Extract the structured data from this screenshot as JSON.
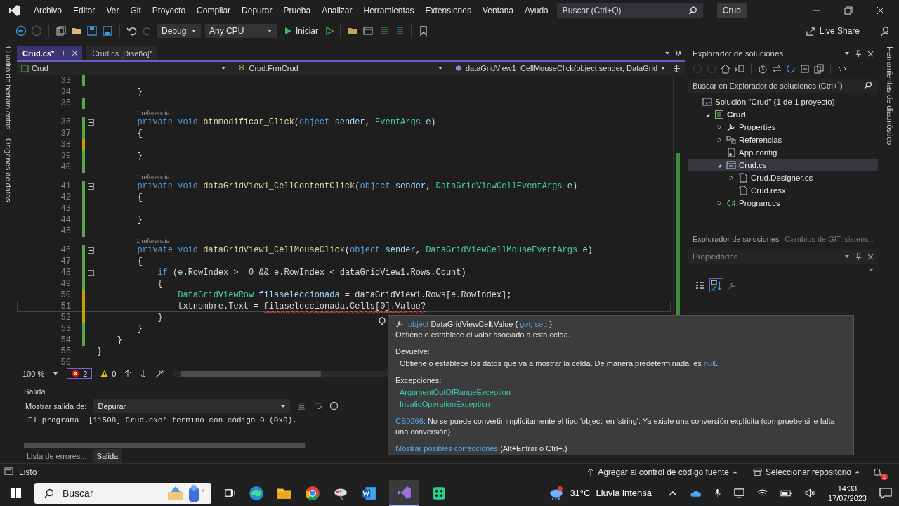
{
  "menu": [
    "Archivo",
    "Editar",
    "Ver",
    "Git",
    "Proyecto",
    "Compilar",
    "Depurar",
    "Prueba",
    "Analizar",
    "Herramientas",
    "Extensiones",
    "Ventana",
    "Ayuda"
  ],
  "search": {
    "placeholder": "Buscar (Ctrl+Q)"
  },
  "window": {
    "title": "Crud"
  },
  "toolbar": {
    "configuration": "Debug",
    "platform": "Any CPU",
    "start": "Iniciar",
    "live_share": "Live Share"
  },
  "left_tool_tabs": [
    "Cuadro de herramientas",
    "Orígenes de datos"
  ],
  "right_tool_tabs": [
    "Herramientas de diagnóstico"
  ],
  "document_tabs": [
    {
      "label": "Crud.cs*",
      "selected": true
    },
    {
      "label": "Crud.cs [Diseño]*",
      "selected": false
    }
  ],
  "navigation": {
    "project": "Crud",
    "type": "Crud.FrmCrud",
    "member": "dataGridView1_CellMouseClick(object sender, DataGrid"
  },
  "code_lines": [
    {
      "num": "33",
      "color": "#57a64a"
    },
    {
      "num": "34",
      "tokens": [
        {
          "text": "        }",
          "kind": "t"
        }
      ]
    },
    {
      "num": "35",
      "color": "#57a64a"
    },
    {
      "num": "36",
      "ref": "1 referencia",
      "foldable": true,
      "color": "#57a64a",
      "tokens": [
        {
          "text": "        private void ",
          "kind": "kw"
        },
        {
          "text": "btnmodificar_Click",
          "kind": "method"
        },
        {
          "text": "(",
          "kind": "t"
        },
        {
          "text": "object ",
          "kind": "kw"
        },
        {
          "text": "sender",
          "kind": "var"
        },
        {
          "text": ", ",
          "kind": "t"
        },
        {
          "text": "EventArgs ",
          "kind": "type"
        },
        {
          "text": "e",
          "kind": "var"
        },
        {
          "text": ")",
          "kind": "t"
        }
      ]
    },
    {
      "num": "37",
      "color": "#57a64a",
      "tokens": [
        {
          "text": "        {",
          "kind": "t"
        }
      ]
    },
    {
      "num": "38",
      "color": "#c5a100"
    },
    {
      "num": "39",
      "color": "#57a64a",
      "tokens": [
        {
          "text": "        }",
          "kind": "t"
        }
      ]
    },
    {
      "num": "40",
      "color": "#57a64a"
    },
    {
      "num": "41",
      "ref": "1 referencia",
      "foldable": true,
      "color": "#57a64a",
      "tokens": [
        {
          "text": "        private void ",
          "kind": "kw"
        },
        {
          "text": "dataGridView1_CellContentClick",
          "kind": "method"
        },
        {
          "text": "(",
          "kind": "t"
        },
        {
          "text": "object ",
          "kind": "kw"
        },
        {
          "text": "sender",
          "kind": "var"
        },
        {
          "text": ", ",
          "kind": "t"
        },
        {
          "text": "DataGridViewCellEventArgs ",
          "kind": "type"
        },
        {
          "text": "e",
          "kind": "var"
        },
        {
          "text": ")",
          "kind": "t"
        }
      ]
    },
    {
      "num": "42",
      "color": "#57a64a",
      "tokens": [
        {
          "text": "        {",
          "kind": "t"
        }
      ]
    },
    {
      "num": "43",
      "color": "#57a64a"
    },
    {
      "num": "44",
      "color": "#57a64a",
      "tokens": [
        {
          "text": "        }",
          "kind": "t"
        }
      ]
    },
    {
      "num": "45",
      "color": "#57a64a"
    },
    {
      "num": "46",
      "ref": "1 referencia",
      "foldable": true,
      "color": "#57a64a",
      "tokens": [
        {
          "text": "        private void ",
          "kind": "kw"
        },
        {
          "text": "dataGridView1_CellMouseClick",
          "kind": "method"
        },
        {
          "text": "(",
          "kind": "t"
        },
        {
          "text": "object ",
          "kind": "kw"
        },
        {
          "text": "sender",
          "kind": "var"
        },
        {
          "text": ", ",
          "kind": "t"
        },
        {
          "text": "DataGridViewCellMouseEventArgs ",
          "kind": "type"
        },
        {
          "text": "e",
          "kind": "var"
        },
        {
          "text": ")",
          "kind": "t"
        }
      ]
    },
    {
      "num": "47",
      "color": "#57a64a",
      "tokens": [
        {
          "text": "        {",
          "kind": "t"
        }
      ]
    },
    {
      "num": "48",
      "foldable": true,
      "color": "#57a64a",
      "tokens": [
        {
          "text": "            if ",
          "kind": "kw"
        },
        {
          "text": "(",
          "kind": "t"
        },
        {
          "text": "e",
          "kind": "var"
        },
        {
          "text": ".RowIndex >= 0 && ",
          "kind": "t"
        },
        {
          "text": "e",
          "kind": "var"
        },
        {
          "text": ".RowIndex < dataGridView1.Rows.Count)",
          "kind": "t"
        }
      ]
    },
    {
      "num": "49",
      "color": "#57a64a",
      "tokens": [
        {
          "text": "            {",
          "kind": "t"
        }
      ]
    },
    {
      "num": "50",
      "color": "#c5a100",
      "tokens": [
        {
          "text": "                DataGridViewRow ",
          "kind": "type"
        },
        {
          "text": "filaseleccionada",
          "kind": "var"
        },
        {
          "text": " = dataGridView1.Rows[",
          "kind": "t"
        },
        {
          "text": "e",
          "kind": "var"
        },
        {
          "text": ".RowIndex];",
          "kind": "t"
        }
      ]
    },
    {
      "num": "51",
      "color": "#c5a100",
      "current": true,
      "tokens": [
        {
          "text": "                txtnombre.Text = ",
          "kind": "t"
        },
        {
          "text": "filaseleccionada.Cells[0].Value?",
          "kind": "error"
        }
      ]
    },
    {
      "num": "52",
      "color": "#c5a100",
      "tokens": [
        {
          "text": "            }",
          "kind": "t"
        }
      ]
    },
    {
      "num": "53",
      "color": "#57a64a",
      "tokens": [
        {
          "text": "        }",
          "kind": "t"
        }
      ]
    },
    {
      "num": "54",
      "color": "#57a64a",
      "tokens": [
        {
          "text": "    }",
          "kind": "t"
        }
      ]
    },
    {
      "num": "55",
      "tokens": [
        {
          "text": "}",
          "kind": "t"
        }
      ]
    },
    {
      "num": "56"
    }
  ],
  "editor_status": {
    "zoom": "100 %",
    "errors": "2",
    "warnings": "0"
  },
  "output": {
    "title": "Salida",
    "source_label": "Mostrar salida de:",
    "source": "Depurar",
    "lines": [
      "El programa '[11508] Crud.exe' terminó con código 0 (0x0)."
    ]
  },
  "bottom_tabs": [
    {
      "label": "Lista de errores...",
      "selected": false
    },
    {
      "label": "Salida",
      "selected": true
    }
  ],
  "solution_explorer": {
    "title": "Explorador de soluciones",
    "search": {
      "placeholder": "Buscar en Explorador de soluciones (Ctrl+`)"
    },
    "tree": [
      {
        "label": "Solución \"Crud\"  (1 de 1 proyecto)",
        "kind": "solution",
        "selected": false,
        "children": [
          {
            "label": "Crud",
            "kind": "project",
            "bold": true,
            "expanded": true,
            "selected": false,
            "children": [
              {
                "label": "Properties",
                "kind": "properties",
                "expanded": false,
                "selected": false
              },
              {
                "label": "Referencias",
                "kind": "references",
                "expanded": false,
                "selected": false
              },
              {
                "label": "App.config",
                "kind": "config",
                "selected": false
              },
              {
                "label": "Crud.cs",
                "kind": "form",
                "expanded": true,
                "selected": true,
                "children": [
                  {
                    "label": "Crud.Designer.cs",
                    "kind": "file",
                    "expanded": false,
                    "selected": false
                  },
                  {
                    "label": "Crud.resx",
                    "kind": "file",
                    "selected": false
                  }
                ]
              },
              {
                "label": "Program.cs",
                "kind": "csharp",
                "expanded": false,
                "selected": false
              }
            ]
          }
        ]
      }
    ]
  },
  "right_tabs": [
    {
      "label": "Explorador de soluciones",
      "selected": true
    },
    {
      "label": "Cambios de GIT: sistem...",
      "selected": false
    }
  ],
  "properties": {
    "title": "Propiedades"
  },
  "tooltip": {
    "signature": [
      {
        "text": "object",
        "kind": "kw"
      },
      {
        "text": " DataGridViewCell.Value { ",
        "kind": "t"
      },
      {
        "text": "get",
        "kind": "kw"
      },
      {
        "text": "; ",
        "kind": "t"
      },
      {
        "text": "set",
        "kind": "kw"
      },
      {
        "text": "; }",
        "kind": "t"
      }
    ],
    "summary": "Obtiene o establece el valor asociado a esta celda.",
    "returns_label": "Devuelve:",
    "returns": [
      {
        "text": "Obtiene o establece los datos que va a mostrar la celda. De manera predeterminada, es ",
        "kind": "t"
      },
      {
        "text": "null",
        "kind": "kw"
      },
      {
        "text": ".",
        "kind": "t"
      }
    ],
    "exceptions_label": "Excepciones:",
    "exceptions": [
      "ArgumentOutOfRangeException",
      "InvalidOperationException"
    ],
    "error_code": "CS0266",
    "error_message": ": No se puede convertir implícitamente el tipo 'object' en 'string'. Ya existe una conversión explícita (compruebe si le falta una conversión)",
    "fix_link": "Mostrar posibles correcciones",
    "fix_hint": " (Alt+Entrar o Ctrl+.)"
  },
  "status_bar": {
    "state": "Listo",
    "source_control": "Agregar al control de código fuente",
    "repository": "Seleccionar repositorio",
    "notifications": "1"
  },
  "taskbar": {
    "search": {
      "placeholder": "Buscar"
    },
    "weather_temp": "31°C",
    "weather": "Lluvia intensa",
    "time": "14:33",
    "date": "17/07/2023"
  }
}
